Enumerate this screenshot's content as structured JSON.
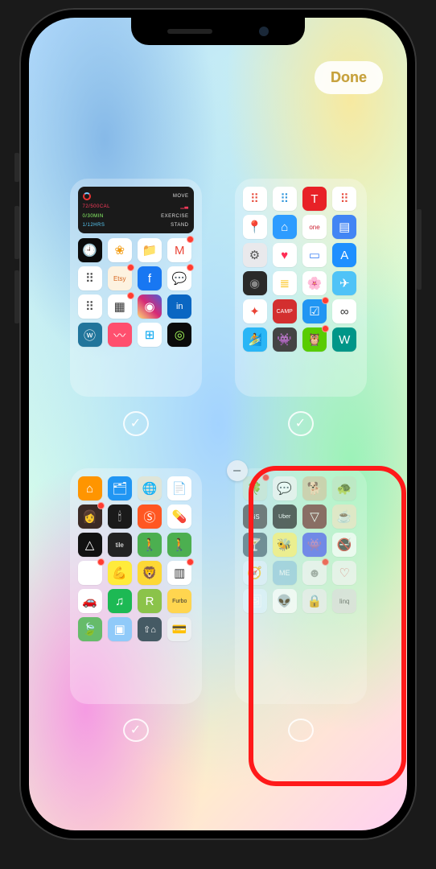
{
  "header": {
    "done_label": "Done"
  },
  "widget": {
    "move_label": "MOVE",
    "move_value": "72/500CAL",
    "exercise_label": "EXERCISE",
    "exercise_value": "0/30MIN",
    "stand_label": "STAND",
    "stand_value": "1/12HRS"
  },
  "pages": [
    {
      "id": "page-1",
      "visible": true,
      "has_widget": true,
      "apps": [
        {
          "name": "clock",
          "bg": "#0b0b0b",
          "glyph": "🕘"
        },
        {
          "name": "photos",
          "bg": "#ffffff",
          "glyph": "❀",
          "fg": "#f39c12"
        },
        {
          "name": "files",
          "bg": "#ffffff",
          "glyph": "📁"
        },
        {
          "name": "gmail",
          "bg": "#ffffff",
          "glyph": "M",
          "fg": "#ea4335",
          "badge": true
        },
        {
          "name": "dots-1",
          "bg": "#ffffff",
          "glyph": "⠿",
          "fg": "#444"
        },
        {
          "name": "etsy",
          "bg": "#fdf2e0",
          "glyph": "Etsy",
          "fg": "#d5641c",
          "fs": 8,
          "badge": true
        },
        {
          "name": "facebook",
          "bg": "#1877f2",
          "glyph": "f"
        },
        {
          "name": "messenger",
          "bg": "#ffffff",
          "glyph": "💬",
          "fg": "#0a7cff",
          "badge": true
        },
        {
          "name": "dots-2",
          "bg": "#ffffff",
          "glyph": "⠿",
          "fg": "#444"
        },
        {
          "name": "squares",
          "bg": "#ffffff",
          "glyph": "▦",
          "fg": "#333",
          "badge": true
        },
        {
          "name": "instagram",
          "bg": "linear-gradient(45deg,#feda75,#d62976,#4f5bd5)",
          "glyph": "◉"
        },
        {
          "name": "linkedin",
          "bg": "#0a66c2",
          "glyph": "in",
          "fs": 11
        },
        {
          "name": "wordpress",
          "bg": "#21759b",
          "glyph": "ⓦ"
        },
        {
          "name": "trend",
          "bg": "#ff4f6e",
          "glyph": "〰"
        },
        {
          "name": "microsoft",
          "bg": "#ffffff",
          "glyph": "⊞",
          "fg": "#00a4ef"
        },
        {
          "name": "activity",
          "bg": "#0b0b0b",
          "glyph": "◎",
          "fg": "#a7ff5b"
        }
      ]
    },
    {
      "id": "page-2",
      "visible": true,
      "apps": [
        {
          "name": "folder-1",
          "bg": "#ffffff",
          "glyph": "⠿",
          "fg": "#e74c3c"
        },
        {
          "name": "folder-2",
          "bg": "#ffffff",
          "glyph": "⠿",
          "fg": "#3498db"
        },
        {
          "name": "tesla",
          "bg": "#e82127",
          "glyph": "T"
        },
        {
          "name": "folder-3",
          "bg": "#ffffff",
          "glyph": "⠿",
          "fg": "#e74c3c"
        },
        {
          "name": "google-maps",
          "bg": "#ffffff",
          "glyph": "📍"
        },
        {
          "name": "home",
          "bg": "#2d9cff",
          "glyph": "⌂"
        },
        {
          "name": "one",
          "bg": "#ffffff",
          "glyph": "one",
          "fg": "#c23",
          "fs": 8
        },
        {
          "name": "docs",
          "bg": "#4285f4",
          "glyph": "▤"
        },
        {
          "name": "settings",
          "bg": "#e9e9ec",
          "glyph": "⚙︎",
          "fg": "#555"
        },
        {
          "name": "health",
          "bg": "#ffffff",
          "glyph": "♥",
          "fg": "#ff2d55"
        },
        {
          "name": "calendar",
          "bg": "#ffffff",
          "glyph": "▭",
          "fg": "#4285f4"
        },
        {
          "name": "appstore",
          "bg": "#1e90ff",
          "glyph": "A"
        },
        {
          "name": "camera",
          "bg": "#2a2a2a",
          "glyph": "◉",
          "fg": "#888"
        },
        {
          "name": "notes",
          "bg": "#ffffff",
          "glyph": "≣",
          "fg": "#fbbc04"
        },
        {
          "name": "flower",
          "bg": "#ffffff",
          "glyph": "🌸"
        },
        {
          "name": "sky",
          "bg": "#4fc3f7",
          "glyph": "✈"
        },
        {
          "name": "google-photos",
          "bg": "#ffffff",
          "glyph": "✦",
          "fg": "#ea4335"
        },
        {
          "name": "camp",
          "bg": "#d32f2f",
          "glyph": "CAMP",
          "fs": 7
        },
        {
          "name": "todo",
          "bg": "#2196f3",
          "glyph": "☑",
          "badge": true
        },
        {
          "name": "rings",
          "bg": "#ffffff",
          "glyph": "∞",
          "fg": "#333"
        },
        {
          "name": "surfer",
          "bg": "#29b6f6",
          "glyph": "🏄"
        },
        {
          "name": "pixel",
          "bg": "#444",
          "glyph": "👾"
        },
        {
          "name": "duo",
          "bg": "#58cc02",
          "glyph": "🦉",
          "badge": true
        },
        {
          "name": "wgame",
          "bg": "#009688",
          "glyph": "W"
        }
      ]
    },
    {
      "id": "page-3",
      "visible": true,
      "tall": true,
      "apps": [
        {
          "name": "home-orange",
          "bg": "#ff9500",
          "glyph": "⌂"
        },
        {
          "name": "files-2",
          "bg": "#2196f3",
          "glyph": "🗂"
        },
        {
          "name": "globe",
          "bg": "#dfe5d8",
          "glyph": "🌐",
          "fg": "#555"
        },
        {
          "name": "note",
          "bg": "#ffffff",
          "glyph": "📄"
        },
        {
          "name": "portrait",
          "bg": "#3b2a25",
          "glyph": "👩",
          "badge": true
        },
        {
          "name": "candle",
          "bg": "#1a1a1a",
          "glyph": "🕯"
        },
        {
          "name": "circle-s",
          "bg": "#ff5722",
          "glyph": "Ⓢ"
        },
        {
          "name": "pills",
          "bg": "#ffffff",
          "glyph": "💊"
        },
        {
          "name": "triangle",
          "bg": "#111",
          "glyph": "△"
        },
        {
          "name": "tile",
          "bg": "#222",
          "glyph": "tile",
          "fs": 8
        },
        {
          "name": "walk-1",
          "bg": "#4caf50",
          "glyph": "🚶"
        },
        {
          "name": "walk-2",
          "bg": "#4caf50",
          "glyph": "🚶"
        },
        {
          "name": "folder-a",
          "bg": "#ffffff",
          "glyph": "🗂",
          "badge": true
        },
        {
          "name": "flex",
          "bg": "#ffeb3b",
          "glyph": "💪"
        },
        {
          "name": "lion",
          "bg": "#fdd835",
          "glyph": "🦁"
        },
        {
          "name": "barcode",
          "bg": "#ffffff",
          "glyph": "▥",
          "fg": "#333",
          "badge": true
        },
        {
          "name": "car",
          "bg": "#ffffff",
          "glyph": "🚗",
          "fg": "#333"
        },
        {
          "name": "spotify",
          "bg": "#1db954",
          "glyph": "♫"
        },
        {
          "name": "r-app",
          "bg": "#8bc34a",
          "glyph": "R"
        },
        {
          "name": "furbo",
          "bg": "#ffd54f",
          "glyph": "Furbo",
          "fs": 7,
          "fg": "#333"
        },
        {
          "name": "leaf",
          "bg": "#66bb6a",
          "glyph": "🍃"
        },
        {
          "name": "layers",
          "bg": "#90caf9",
          "glyph": "▣"
        },
        {
          "name": "house-up",
          "bg": "#455a64",
          "glyph": "⇧⌂",
          "fs": 11
        },
        {
          "name": "card",
          "bg": "#eceff1",
          "glyph": "💳"
        }
      ]
    },
    {
      "id": "page-4",
      "visible": false,
      "tall": true,
      "dim": true,
      "removable": true,
      "apps": [
        {
          "name": "clover",
          "bg": "#cfe8d6",
          "glyph": "🍀",
          "badge": true
        },
        {
          "name": "bubble",
          "bg": "#f5f5f5",
          "glyph": "💬",
          "fg": "#999"
        },
        {
          "name": "dog",
          "bg": "#d7c9a7",
          "glyph": "🐕"
        },
        {
          "name": "turtle",
          "bg": "#c8e6c9",
          "glyph": "🐢"
        },
        {
          "name": "sis",
          "bg": "#555",
          "glyph": "SiS",
          "fs": 8
        },
        {
          "name": "uber-eats",
          "bg": "#333",
          "glyph": "Uber",
          "fs": 7
        },
        {
          "name": "shorts",
          "bg": "#7b3f3f",
          "glyph": "▽"
        },
        {
          "name": "coffee",
          "bg": "#f3e5ca",
          "glyph": "☕"
        },
        {
          "name": "cocktail",
          "bg": "#546e7a",
          "glyph": "🍸"
        },
        {
          "name": "bee",
          "bg": "#fff176",
          "glyph": "🐝"
        },
        {
          "name": "discord",
          "bg": "#5865f2",
          "glyph": "👾"
        },
        {
          "name": "nosmoking",
          "bg": "#fff",
          "glyph": "🚭"
        },
        {
          "name": "compass",
          "bg": "#e3f2fd",
          "glyph": "🧭"
        },
        {
          "name": "me",
          "bg": "#9ccce0",
          "glyph": "ME",
          "fs": 9
        },
        {
          "name": "face",
          "bg": "#f5f5f5",
          "glyph": "☻",
          "fg": "#999",
          "badge": true
        },
        {
          "name": "hearts",
          "bg": "#f5f5f5",
          "glyph": "♡",
          "fg": "#e57373"
        },
        {
          "name": "photo",
          "bg": "#e1f5fe",
          "glyph": "🖼"
        },
        {
          "name": "alien",
          "bg": "#fff",
          "glyph": "👽",
          "fg": "#ff7043"
        },
        {
          "name": "lock",
          "bg": "#eeeeef",
          "glyph": "🔒",
          "fg": "#888"
        },
        {
          "name": "linq",
          "bg": "#e0e0e0",
          "glyph": "linq",
          "fs": 8,
          "fg": "#555"
        }
      ]
    }
  ],
  "annotation": {
    "highlight_page": "page-4"
  }
}
